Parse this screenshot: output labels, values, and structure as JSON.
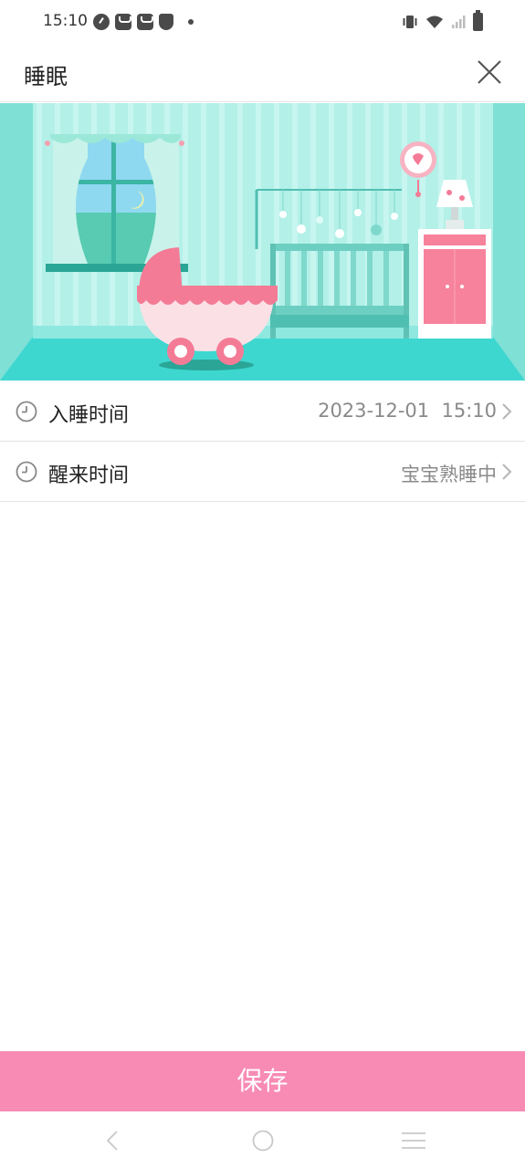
{
  "status_bar": {
    "time": "15:10",
    "left_icons": [
      "speedometer-icon",
      "mail-icon",
      "mail-icon",
      "shield-icon",
      "dot-icon"
    ],
    "right_icons": [
      "vibrate-icon",
      "wifi-icon",
      "signal-icon",
      "battery-icon"
    ]
  },
  "header": {
    "title": "睡眠",
    "close_icon": "close-icon"
  },
  "hero": {
    "scene": "nursery-illustration",
    "colors": {
      "wall": "#a8ece4",
      "floor": "#3dd7d0",
      "crib": "#6ccfc2",
      "stroller": "#f47b96",
      "dresser": "#f7829b"
    }
  },
  "rows": [
    {
      "label": "入睡时间",
      "value": "2023-12-01  15:10",
      "icon": "clock-icon"
    },
    {
      "label": "醒来时间",
      "value": "宝宝熟睡中",
      "icon": "clock-icon"
    }
  ],
  "save_button": {
    "label": "保存",
    "color": "#f78bb4"
  },
  "nav_bar": {
    "icons": [
      "back-icon",
      "home-icon",
      "menu-icon"
    ]
  }
}
